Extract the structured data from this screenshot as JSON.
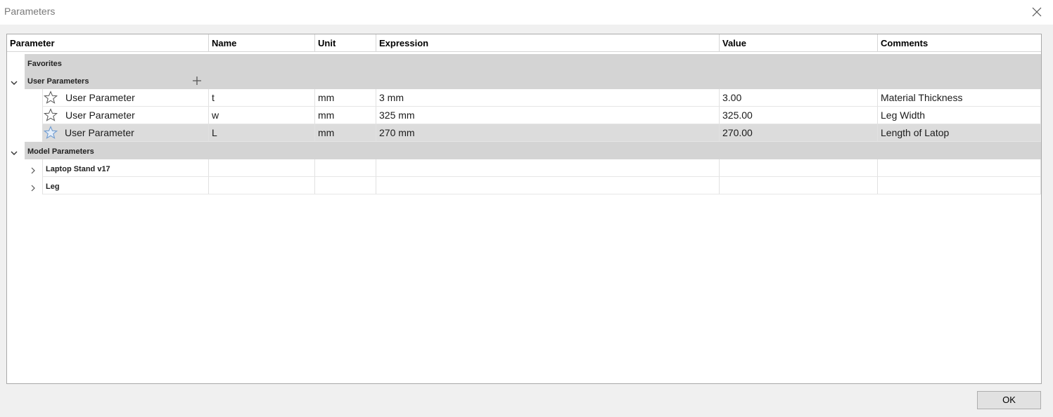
{
  "window": {
    "title": "Parameters"
  },
  "columns": {
    "parameter": "Parameter",
    "name": "Name",
    "unit": "Unit",
    "expression": "Expression",
    "value": "Value",
    "comments": "Comments"
  },
  "groups": {
    "favorites": "Favorites",
    "user_parameters": "User Parameters",
    "model_parameters": "Model Parameters"
  },
  "user_params": [
    {
      "label": "User Parameter",
      "name": "t",
      "unit": "mm",
      "expression": "3 mm",
      "value": "3.00",
      "comment": "Material Thickness"
    },
    {
      "label": "User Parameter",
      "name": "w",
      "unit": "mm",
      "expression": "325 mm",
      "value": "325.00",
      "comment": "Leg Width"
    },
    {
      "label": "User Parameter",
      "name": "L",
      "unit": "mm",
      "expression": "270 mm",
      "value": "270.00",
      "comment": "Length of Latop"
    }
  ],
  "models": [
    {
      "label": "Laptop Stand v17"
    },
    {
      "label": "Leg"
    }
  ],
  "footer": {
    "ok_label": "OK"
  },
  "colors": {
    "group_row": "#d4d4d4",
    "selected_row": "#dcdcdc",
    "star_selected": "#6e9bd1"
  },
  "icons": [
    "close-icon",
    "chevron-down-icon",
    "plus-icon",
    "star-icon",
    "chevron-right-icon"
  ]
}
